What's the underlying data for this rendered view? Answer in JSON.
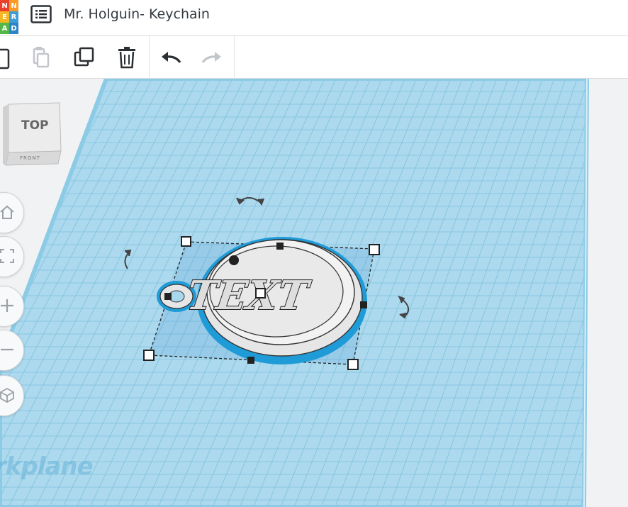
{
  "app": {
    "logo_letters": [
      "N",
      "N",
      "E",
      "R",
      "A",
      "D"
    ],
    "logo_colors": [
      "#e8412c",
      "#f79b25",
      "#f7b723",
      "#3d9dd6",
      "#54b848",
      "#2c86c6"
    ]
  },
  "header": {
    "title": "Mr. Holguin- Keychain",
    "icons": [
      "list-icon"
    ]
  },
  "toolbar": {
    "buttons": [
      "paste-icon",
      "duplicate-icon",
      "copy-icon",
      "delete-icon",
      "undo-icon",
      "redo-icon"
    ]
  },
  "viewcube": {
    "top_label": "TOP",
    "front_label": "FRONT"
  },
  "nav_buttons": [
    "home-view-icon",
    "fit-view-icon",
    "zoom-in-icon",
    "zoom-out-icon",
    "perspective-icon"
  ],
  "workplane": {
    "label": "rkplane",
    "color": "#a8d8ec",
    "grid_color": "#7fc1dd"
  },
  "object": {
    "text": "TEXT",
    "selection_color": "#1e88c7"
  }
}
